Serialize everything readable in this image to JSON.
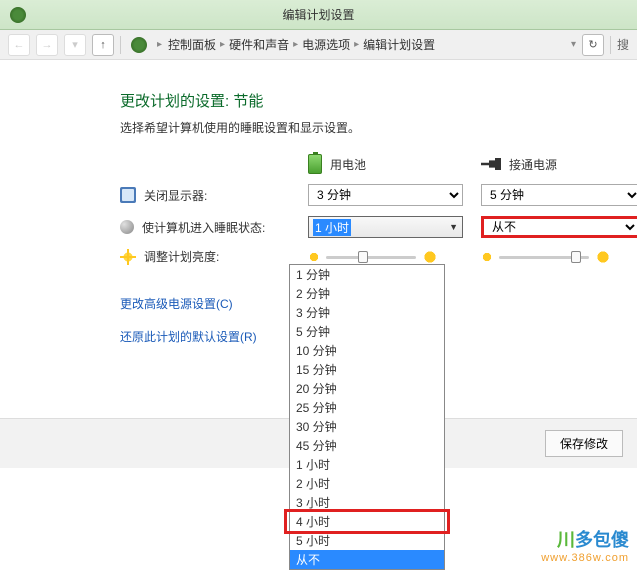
{
  "title": "编辑计划设置",
  "breadcrumb": [
    "控制面板",
    "硬件和声音",
    "电源选项",
    "编辑计划设置"
  ],
  "heading": "更改计划的设置: 节能",
  "subtext": "选择希望计算机使用的睡眠设置和显示设置。",
  "columns": {
    "battery": "用电池",
    "plugged": "接通电源"
  },
  "rows": {
    "display_off": "关闭显示器:",
    "sleep": "使计算机进入睡眠状态:",
    "brightness": "调整计划亮度:"
  },
  "values": {
    "display_off_battery": "3 分钟",
    "display_off_plugged": "5 分钟",
    "sleep_battery": "1 小时",
    "sleep_plugged": "从不"
  },
  "time_options": [
    "1 分钟",
    "2 分钟",
    "3 分钟",
    "5 分钟",
    "10 分钟",
    "15 分钟",
    "20 分钟",
    "25 分钟",
    "30 分钟",
    "45 分钟",
    "1 小时",
    "2 小时",
    "3 小时",
    "4 小时",
    "5 小时",
    "从不"
  ],
  "links": {
    "advanced": "更改高级电源设置(C)",
    "restore": "还原此计划的默认设置(R)"
  },
  "buttons": {
    "save": "保存修改"
  },
  "nav_right_label": "搜",
  "dropdown": {
    "highlight_index": 15
  },
  "watermark": {
    "logo_html": "多包傻",
    "url": "www.386w.com"
  }
}
